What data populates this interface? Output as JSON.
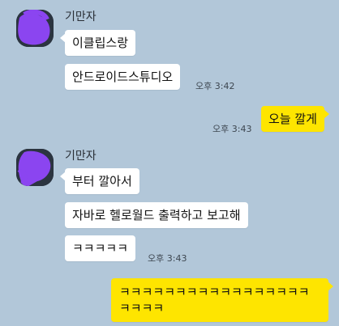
{
  "conversation": {
    "groups": [
      {
        "sender": "기만자",
        "messages": [
          "이클립스랑",
          "안드로이드스튜디오"
        ],
        "time": "오후 3:42"
      },
      {
        "sender": "me",
        "messages": [
          "오늘 깔게"
        ],
        "time": "오후 3:43"
      },
      {
        "sender": "기만자",
        "messages": [
          "부터 깔아서",
          "자바로 헬로월드 출력하고 보고해",
          "ㅋㅋㅋㅋㅋ"
        ],
        "time": "오후 3:43"
      },
      {
        "sender": "me",
        "messages": [
          "ㅋㅋㅋㅋㅋㅋㅋㅋㅋㅋㅋㅋㅋㅋㅋㅋㅋㅋㅋㅋㅋ"
        ]
      }
    ]
  },
  "colors": {
    "background": "#b2c7d9",
    "incoming_bubble": "#ffffff",
    "outgoing_bubble": "#fee500",
    "avatar_scribble": "#8b45f0"
  }
}
